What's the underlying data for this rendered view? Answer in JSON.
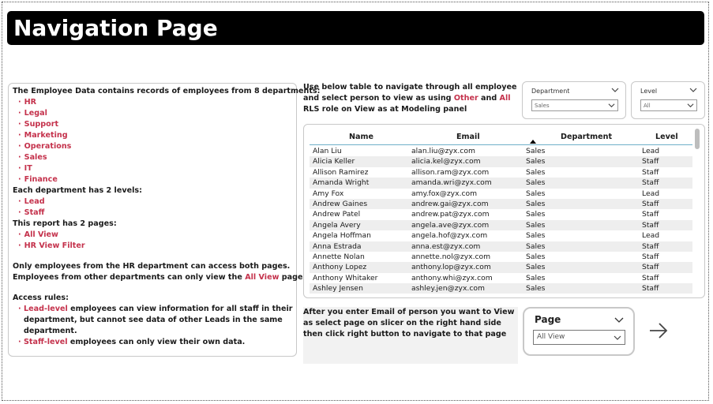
{
  "header": {
    "title": "Navigation Page"
  },
  "info": {
    "intro": "The Employee Data contains records of employees from 8 departments:",
    "departments": [
      "HR",
      "Legal",
      "Support",
      "Marketing",
      "Operations",
      "Sales",
      "IT",
      "Finance"
    ],
    "levels_intro": "Each department has 2 levels:",
    "levels": [
      "Lead",
      "Staff"
    ],
    "pages_intro": "This report has 2 pages:",
    "pages": [
      "All View",
      "HR View Filter"
    ],
    "hr_note_1": "Only employees from the HR department can access both pages.",
    "hr_note_2a": "Employees from other departments can only view the ",
    "hr_note_2b": "All View",
    "hr_note_2c": " page.",
    "access_title": "Access rules:",
    "rule1_red": "Lead-level",
    "rule1_text": " employees can view information for all staff in their department, but cannot see data of other Leads in the same department.",
    "rule2_red": "Staff-level",
    "rule2_text": " employees can only view their own data."
  },
  "instructions": {
    "part1": "Use below table to navigate through all employee and select person to view as using ",
    "other": "Other",
    "part2": " and ",
    "all": "All",
    "part3": " RLS role on View as at Modeling panel",
    "bottom": "After you enter Email of person you want to View as select page on slicer on the right hand side then click right button to navigate to that page"
  },
  "slicers": {
    "department": {
      "title": "Department",
      "value": "Sales"
    },
    "level": {
      "title": "Level",
      "value": "All"
    },
    "page": {
      "title": "Page",
      "value": "All View"
    }
  },
  "table": {
    "columns": [
      "Name",
      "Email",
      "Department",
      "Level"
    ],
    "rows": [
      {
        "name": "Alan Liu",
        "email": "alan.liu@zyx.com",
        "dept": "Sales",
        "level": "Lead"
      },
      {
        "name": "Alicia Keller",
        "email": "alicia.kel@zyx.com",
        "dept": "Sales",
        "level": "Staff"
      },
      {
        "name": "Allison Ramirez",
        "email": "allison.ram@zyx.com",
        "dept": "Sales",
        "level": "Staff"
      },
      {
        "name": "Amanda Wright",
        "email": "amanda.wri@zyx.com",
        "dept": "Sales",
        "level": "Staff"
      },
      {
        "name": "Amy Fox",
        "email": "amy.fox@zyx.com",
        "dept": "Sales",
        "level": "Lead"
      },
      {
        "name": "Andrew Gaines",
        "email": "andrew.gai@zyx.com",
        "dept": "Sales",
        "level": "Staff"
      },
      {
        "name": "Andrew Patel",
        "email": "andrew.pat@zyx.com",
        "dept": "Sales",
        "level": "Staff"
      },
      {
        "name": "Angela Avery",
        "email": "angela.ave@zyx.com",
        "dept": "Sales",
        "level": "Staff"
      },
      {
        "name": "Angela Hoffman",
        "email": "angela.hof@zyx.com",
        "dept": "Sales",
        "level": "Lead"
      },
      {
        "name": "Anna Estrada",
        "email": "anna.est@zyx.com",
        "dept": "Sales",
        "level": "Staff"
      },
      {
        "name": "Annette Nolan",
        "email": "annette.nol@zyx.com",
        "dept": "Sales",
        "level": "Staff"
      },
      {
        "name": "Anthony Lopez",
        "email": "anthony.lop@zyx.com",
        "dept": "Sales",
        "level": "Staff"
      },
      {
        "name": "Anthony Whitaker",
        "email": "anthony.whi@zyx.com",
        "dept": "Sales",
        "level": "Staff"
      },
      {
        "name": "Ashley Jensen",
        "email": "ashley.jen@zyx.com",
        "dept": "Sales",
        "level": "Staff"
      }
    ]
  },
  "icons": {
    "chevron": "chevron-down-icon",
    "arrow": "arrow-right-icon",
    "sort": "sort-ascending-icon"
  },
  "colors": {
    "accent_red": "#c4314b",
    "header_bg": "#000000"
  }
}
